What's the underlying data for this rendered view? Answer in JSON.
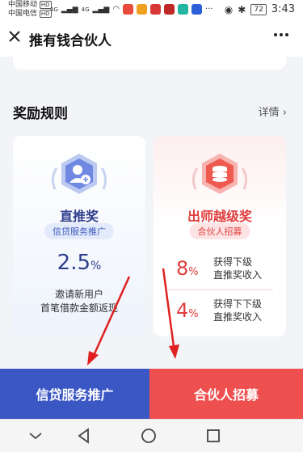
{
  "status_bar": {
    "carrier_1": "中国移动",
    "carrier_1_badge": "HD",
    "carrier_2": "中国电信",
    "carrier_2_badge": "HD",
    "network_1": "4G",
    "network_2": "4G",
    "more_dots": "···",
    "battery": "72",
    "time": "3:43"
  },
  "header": {
    "title": "推有钱合伙人"
  },
  "rewards": {
    "section_title": "奖励规则",
    "details_link": "详情 ›",
    "direct": {
      "name": "直推奖",
      "tag": "信贷服务推广",
      "rate_value": "2.5",
      "rate_unit": "%",
      "desc_line1": "邀请新用户",
      "desc_line2": "首笔借款金额返现"
    },
    "mentor": {
      "name": "出师越级奖",
      "tag": "合伙人招募",
      "rows": [
        {
          "value": "8",
          "unit": "%",
          "line1": "获得下级",
          "line2": "直推奖收入"
        },
        {
          "value": "4",
          "unit": "%",
          "line1": "获得下下级",
          "line2": "直推奖收入"
        }
      ]
    }
  },
  "bottom_buttons": {
    "left_label": "信贷服务推广",
    "right_label": "合伙人招募"
  },
  "colors": {
    "blue_accent": "#3a57c4",
    "red_accent": "#ee4f4f",
    "arrow_red": "#e02020"
  }
}
